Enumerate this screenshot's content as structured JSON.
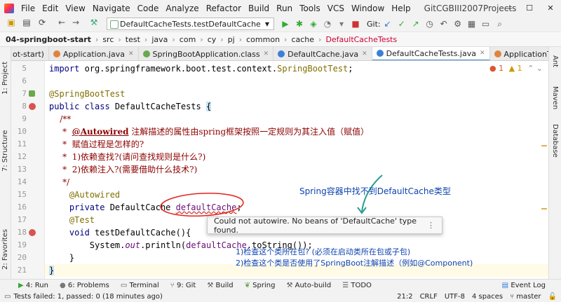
{
  "menubar": {
    "items": [
      "File",
      "Edit",
      "View",
      "Navigate",
      "Code",
      "Analyze",
      "Refactor",
      "Build",
      "Run",
      "Tools",
      "VCS",
      "Window",
      "Help"
    ],
    "project": "GitCGBIII2007Projects",
    "win": [
      "—",
      "☐",
      "✕"
    ]
  },
  "toolbar": {
    "run_config": "DefaultCacheTests.testDefaultCache",
    "git_label": "Git:"
  },
  "breadcrumb": {
    "items": [
      "04-springboot-start",
      "src",
      "test",
      "java",
      "com",
      "cy",
      "pj",
      "common",
      "cache",
      "DefaultCacheTests"
    ]
  },
  "tabs": [
    {
      "label": "ot-start)",
      "color": "#888"
    },
    {
      "label": "Application.java",
      "color": "#e0843c"
    },
    {
      "label": "SpringBootApplication.class",
      "color": "#6aa84f"
    },
    {
      "label": "DefaultCache.java",
      "color": "#3d7fd6"
    },
    {
      "label": "DefaultCacheTests.java",
      "color": "#3d7fd6"
    },
    {
      "label": "ApplicationTests.java",
      "color": "#e0843c"
    }
  ],
  "left_tools": [
    "1: Project",
    "7: Structure",
    "2: Favorites"
  ],
  "right_tools": [
    "Ant",
    "Maven",
    "Database"
  ],
  "gutter": {
    "lines": [
      "5",
      "6",
      "7",
      "8",
      "9",
      "10",
      "11",
      "12",
      "13",
      "14",
      "15",
      "16",
      "17",
      "18",
      "19",
      "20",
      "21"
    ]
  },
  "code": {
    "l5_kw": "import ",
    "l5_rest": "org.springframework.boot.test.context.",
    "l5_cls": "SpringBootTest",
    ";": ";",
    "l7": "@SpringBootTest",
    "l8_kw": "public class ",
    "l8_name": "DefaultCacheTests ",
    "l8_brace": "{",
    "l9": "    /**",
    "l10_star": "     *  ",
    "l10_tag": "@Autowired",
    "l10_text": " 注解描述的属性由spring框架按照一定规则为其注入值（赋值）",
    "l11": "     *  赋值过程是怎样的?",
    "l12": "     *  1)依赖查找?(请问查找规则是什么?)",
    "l13": "     *  2)依赖注入?(需要借助什么技术?)",
    "l14": "     */",
    "l15": "    @Autowired",
    "l16_kw": "    private ",
    "l16_type": "DefaultCache ",
    "l16_field": "defaultCache",
    "l17": "    @Test",
    "l18_kw": "    void ",
    "l18_rest": "testDefaultCache(){",
    "l19_a": "        System.",
    "l19_out": "out",
    "l19_b": ".println(",
    "l19_field": "defaultCache",
    "l19_c": ".toString());",
    "l20": "    }",
    "l21": "}"
  },
  "warnings": {
    "errors": "1",
    "warns": "1"
  },
  "tooltip": {
    "text": "Could not autowire. No beans of 'DefaultCache' type found.",
    "more": "⋮"
  },
  "annotations": {
    "arrow_note": "Spring容器中找不到DefaultCache类型",
    "note1": "1)检查这个类所在包?  (必须在启动类所在包或子包)",
    "note2": "2)检查这个类是否使用了SpringBoot注解描述（例如@Component)"
  },
  "bottom_tools": [
    "4: Run",
    "6: Problems",
    "Terminal",
    "9: Git",
    "Build",
    "Spring",
    "Auto-build",
    "TODO"
  ],
  "event_log": "Event Log",
  "status": {
    "message": "Tests failed: 1, passed: 0 (18 minutes ago)",
    "pos": "21:2",
    "eol": "CRLF",
    "enc": "UTF-8",
    "indent": "4 spaces",
    "branch": "master"
  }
}
